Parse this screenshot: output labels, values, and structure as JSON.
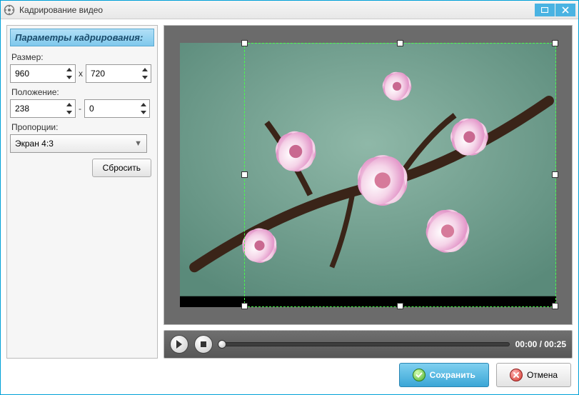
{
  "window": {
    "title": "Кадрирование видео"
  },
  "panel": {
    "header": "Параметры кадрирования:",
    "size_label": "Размер:",
    "size_w": "960",
    "size_sep": "x",
    "size_h": "720",
    "position_label": "Положение:",
    "pos_x": "238",
    "pos_sep": "-",
    "pos_y": "0",
    "aspect_label": "Пропорции:",
    "aspect_value": "Экран 4:3",
    "reset_label": "Сбросить"
  },
  "player": {
    "time": "00:00 / 00:25"
  },
  "footer": {
    "save": "Сохранить",
    "cancel": "Отмена"
  }
}
